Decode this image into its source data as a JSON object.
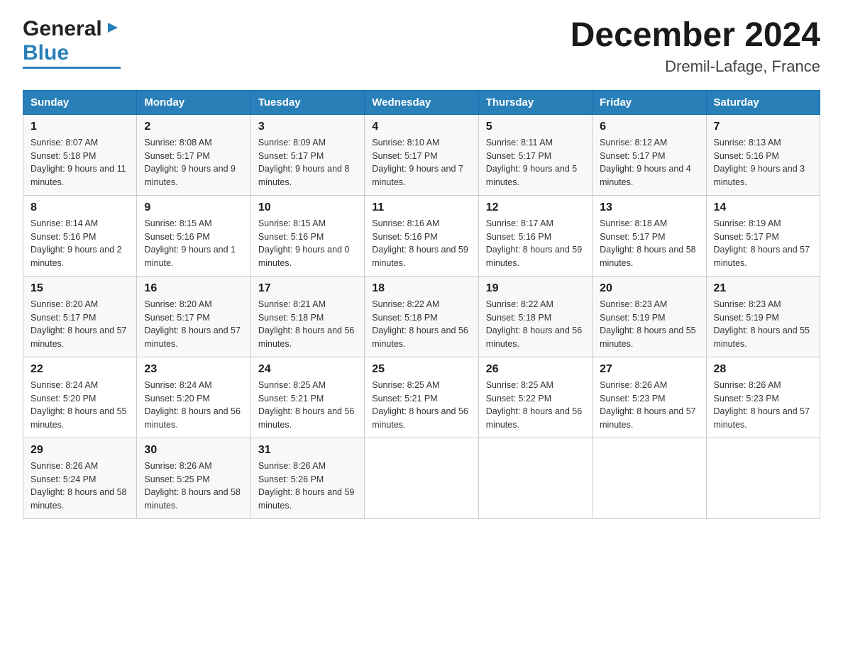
{
  "header": {
    "logo_general": "General",
    "logo_blue": "Blue",
    "calendar_title": "December 2024",
    "calendar_subtitle": "Dremil-Lafage, France"
  },
  "days_of_week": [
    "Sunday",
    "Monday",
    "Tuesday",
    "Wednesday",
    "Thursday",
    "Friday",
    "Saturday"
  ],
  "weeks": [
    [
      {
        "day": "1",
        "sunrise": "8:07 AM",
        "sunset": "5:18 PM",
        "daylight": "9 hours and 11 minutes."
      },
      {
        "day": "2",
        "sunrise": "8:08 AM",
        "sunset": "5:17 PM",
        "daylight": "9 hours and 9 minutes."
      },
      {
        "day": "3",
        "sunrise": "8:09 AM",
        "sunset": "5:17 PM",
        "daylight": "9 hours and 8 minutes."
      },
      {
        "day": "4",
        "sunrise": "8:10 AM",
        "sunset": "5:17 PM",
        "daylight": "9 hours and 7 minutes."
      },
      {
        "day": "5",
        "sunrise": "8:11 AM",
        "sunset": "5:17 PM",
        "daylight": "9 hours and 5 minutes."
      },
      {
        "day": "6",
        "sunrise": "8:12 AM",
        "sunset": "5:17 PM",
        "daylight": "9 hours and 4 minutes."
      },
      {
        "day": "7",
        "sunrise": "8:13 AM",
        "sunset": "5:16 PM",
        "daylight": "9 hours and 3 minutes."
      }
    ],
    [
      {
        "day": "8",
        "sunrise": "8:14 AM",
        "sunset": "5:16 PM",
        "daylight": "9 hours and 2 minutes."
      },
      {
        "day": "9",
        "sunrise": "8:15 AM",
        "sunset": "5:16 PM",
        "daylight": "9 hours and 1 minute."
      },
      {
        "day": "10",
        "sunrise": "8:15 AM",
        "sunset": "5:16 PM",
        "daylight": "9 hours and 0 minutes."
      },
      {
        "day": "11",
        "sunrise": "8:16 AM",
        "sunset": "5:16 PM",
        "daylight": "8 hours and 59 minutes."
      },
      {
        "day": "12",
        "sunrise": "8:17 AM",
        "sunset": "5:16 PM",
        "daylight": "8 hours and 59 minutes."
      },
      {
        "day": "13",
        "sunrise": "8:18 AM",
        "sunset": "5:17 PM",
        "daylight": "8 hours and 58 minutes."
      },
      {
        "day": "14",
        "sunrise": "8:19 AM",
        "sunset": "5:17 PM",
        "daylight": "8 hours and 57 minutes."
      }
    ],
    [
      {
        "day": "15",
        "sunrise": "8:20 AM",
        "sunset": "5:17 PM",
        "daylight": "8 hours and 57 minutes."
      },
      {
        "day": "16",
        "sunrise": "8:20 AM",
        "sunset": "5:17 PM",
        "daylight": "8 hours and 57 minutes."
      },
      {
        "day": "17",
        "sunrise": "8:21 AM",
        "sunset": "5:18 PM",
        "daylight": "8 hours and 56 minutes."
      },
      {
        "day": "18",
        "sunrise": "8:22 AM",
        "sunset": "5:18 PM",
        "daylight": "8 hours and 56 minutes."
      },
      {
        "day": "19",
        "sunrise": "8:22 AM",
        "sunset": "5:18 PM",
        "daylight": "8 hours and 56 minutes."
      },
      {
        "day": "20",
        "sunrise": "8:23 AM",
        "sunset": "5:19 PM",
        "daylight": "8 hours and 55 minutes."
      },
      {
        "day": "21",
        "sunrise": "8:23 AM",
        "sunset": "5:19 PM",
        "daylight": "8 hours and 55 minutes."
      }
    ],
    [
      {
        "day": "22",
        "sunrise": "8:24 AM",
        "sunset": "5:20 PM",
        "daylight": "8 hours and 55 minutes."
      },
      {
        "day": "23",
        "sunrise": "8:24 AM",
        "sunset": "5:20 PM",
        "daylight": "8 hours and 56 minutes."
      },
      {
        "day": "24",
        "sunrise": "8:25 AM",
        "sunset": "5:21 PM",
        "daylight": "8 hours and 56 minutes."
      },
      {
        "day": "25",
        "sunrise": "8:25 AM",
        "sunset": "5:21 PM",
        "daylight": "8 hours and 56 minutes."
      },
      {
        "day": "26",
        "sunrise": "8:25 AM",
        "sunset": "5:22 PM",
        "daylight": "8 hours and 56 minutes."
      },
      {
        "day": "27",
        "sunrise": "8:26 AM",
        "sunset": "5:23 PM",
        "daylight": "8 hours and 57 minutes."
      },
      {
        "day": "28",
        "sunrise": "8:26 AM",
        "sunset": "5:23 PM",
        "daylight": "8 hours and 57 minutes."
      }
    ],
    [
      {
        "day": "29",
        "sunrise": "8:26 AM",
        "sunset": "5:24 PM",
        "daylight": "8 hours and 58 minutes."
      },
      {
        "day": "30",
        "sunrise": "8:26 AM",
        "sunset": "5:25 PM",
        "daylight": "8 hours and 58 minutes."
      },
      {
        "day": "31",
        "sunrise": "8:26 AM",
        "sunset": "5:26 PM",
        "daylight": "8 hours and 59 minutes."
      },
      null,
      null,
      null,
      null
    ]
  ],
  "labels": {
    "sunrise": "Sunrise:",
    "sunset": "Sunset:",
    "daylight": "Daylight:"
  }
}
